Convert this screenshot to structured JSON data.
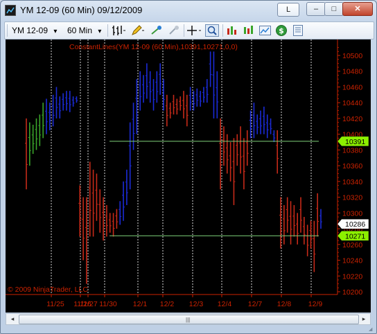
{
  "window": {
    "title": "YM 12-09 (60 Min)  09/12/2009",
    "link_button": "L",
    "minimize": "–",
    "maximize": "□",
    "close": "✕"
  },
  "toolbar": {
    "instrument": "YM 12-09",
    "interval": "60 Min",
    "dropdown": "▾",
    "icons": [
      "bar-type-icon",
      "pencil-icon",
      "crosshair-tool-icon",
      "eraser-icon",
      "crosshair-icon",
      "zoom-icon",
      "indicators-icon",
      "strategies-icon",
      "properties-icon",
      "dollar-icon",
      "data-box-icon"
    ]
  },
  "chart": {
    "indicator_label": "ConstantLines(YM 12-09 (60 Min),10391,10271,0,0)",
    "copyright": "© 2009 NinjaTrader, LLC",
    "colors": {
      "up": "#1b2bd6",
      "down": "#c62a19",
      "neutral": "#3aa52a",
      "axis": "#cc2200",
      "line": "#7fd37a",
      "grid": "#ffffff"
    },
    "price_labels": [
      "10500",
      "10480",
      "10460",
      "10440",
      "10420",
      "10400",
      "10380",
      "10360",
      "10340",
      "10320",
      "10300",
      "10280",
      "10260",
      "10240",
      "10220",
      "10200"
    ],
    "flags": {
      "upper": "10391",
      "last": "10286",
      "lower": "10271"
    },
    "date_labels": [
      "11/25",
      "11/26",
      "11/27",
      "11/30",
      "12/1",
      "12/2",
      "12/3",
      "12/4",
      "12/7",
      "12/8",
      "12/9"
    ]
  },
  "chart_data": {
    "type": "ohlc",
    "title": "ConstantLines(YM 12-09 (60 Min),10391,10271,0,0)",
    "ylim": [
      10200,
      10510
    ],
    "constant_lines": [
      10391,
      10271
    ],
    "last_price": 10286,
    "x_categories": [
      "11/25",
      "11/26",
      "11/27",
      "11/30",
      "12/1",
      "12/2",
      "12/3",
      "12/4",
      "12/7",
      "12/8",
      "12/9"
    ],
    "bars": [
      {
        "h": 10420,
        "l": 10330,
        "c": "down"
      },
      {
        "h": 10415,
        "l": 10360,
        "c": "neutral"
      },
      {
        "h": 10412,
        "l": 10375,
        "c": "neutral"
      },
      {
        "h": 10420,
        "l": 10380,
        "c": "neutral"
      },
      {
        "h": 10425,
        "l": 10385,
        "c": "neutral"
      },
      {
        "h": 10440,
        "l": 10395,
        "c": "neutral"
      },
      {
        "h": 10445,
        "l": 10400,
        "c": "up"
      },
      {
        "h": 10440,
        "l": 10405,
        "c": "up"
      },
      {
        "h": 10450,
        "l": 10410,
        "c": "up"
      },
      {
        "h": 10460,
        "l": 10420,
        "c": "up"
      },
      {
        "h": 10448,
        "l": 10420,
        "c": "up"
      },
      {
        "h": 10452,
        "l": 10430,
        "c": "up"
      },
      {
        "h": 10455,
        "l": 10430,
        "c": "up"
      },
      {
        "h": 10455,
        "l": 10428,
        "c": "up"
      },
      {
        "h": 10448,
        "l": 10435,
        "c": "up"
      },
      {
        "h": 10448,
        "l": 10440,
        "c": "up"
      },
      {
        "h": 10335,
        "l": 10270,
        "c": "down"
      },
      {
        "h": 10320,
        "l": 10240,
        "c": "down"
      },
      {
        "h": 10320,
        "l": 10210,
        "c": "down"
      },
      {
        "h": 10365,
        "l": 10270,
        "c": "down"
      },
      {
        "h": 10355,
        "l": 10270,
        "c": "down"
      },
      {
        "h": 10350,
        "l": 10290,
        "c": "down"
      },
      {
        "h": 10330,
        "l": 10275,
        "c": "down"
      },
      {
        "h": 10320,
        "l": 10265,
        "c": "down"
      },
      {
        "h": 10310,
        "l": 10270,
        "c": "down"
      },
      {
        "h": 10300,
        "l": 10275,
        "c": "down"
      },
      {
        "h": 10300,
        "l": 10270,
        "c": "down"
      },
      {
        "h": 10305,
        "l": 10280,
        "c": "down"
      },
      {
        "h": 10315,
        "l": 10285,
        "c": "up"
      },
      {
        "h": 10340,
        "l": 10290,
        "c": "up"
      },
      {
        "h": 10355,
        "l": 10310,
        "c": "up"
      },
      {
        "h": 10415,
        "l": 10330,
        "c": "up"
      },
      {
        "h": 10440,
        "l": 10380,
        "c": "up"
      },
      {
        "h": 10470,
        "l": 10400,
        "c": "up"
      },
      {
        "h": 10480,
        "l": 10430,
        "c": "up"
      },
      {
        "h": 10475,
        "l": 10440,
        "c": "up"
      },
      {
        "h": 10490,
        "l": 10445,
        "c": "up"
      },
      {
        "h": 10480,
        "l": 10440,
        "c": "up"
      },
      {
        "h": 10470,
        "l": 10430,
        "c": "up"
      },
      {
        "h": 10480,
        "l": 10440,
        "c": "up"
      },
      {
        "h": 10490,
        "l": 10450,
        "c": "up"
      },
      {
        "h": 10470,
        "l": 10430,
        "c": "up"
      },
      {
        "h": 10450,
        "l": 10410,
        "c": "down"
      },
      {
        "h": 10440,
        "l": 10420,
        "c": "down"
      },
      {
        "h": 10450,
        "l": 10425,
        "c": "down"
      },
      {
        "h": 10445,
        "l": 10425,
        "c": "down"
      },
      {
        "h": 10448,
        "l": 10430,
        "c": "down"
      },
      {
        "h": 10455,
        "l": 10420,
        "c": "down"
      },
      {
        "h": 10450,
        "l": 10410,
        "c": "down"
      },
      {
        "h": 10460,
        "l": 10430,
        "c": "up"
      },
      {
        "h": 10455,
        "l": 10430,
        "c": "up"
      },
      {
        "h": 10458,
        "l": 10435,
        "c": "up"
      },
      {
        "h": 10455,
        "l": 10435,
        "c": "up"
      },
      {
        "h": 10460,
        "l": 10440,
        "c": "up"
      },
      {
        "h": 10470,
        "l": 10440,
        "c": "up"
      },
      {
        "h": 10505,
        "l": 10460,
        "c": "up"
      },
      {
        "h": 10505,
        "l": 10420,
        "c": "up"
      },
      {
        "h": 10480,
        "l": 10420,
        "c": "up"
      },
      {
        "h": 10420,
        "l": 10330,
        "c": "down"
      },
      {
        "h": 10410,
        "l": 10360,
        "c": "down"
      },
      {
        "h": 10400,
        "l": 10350,
        "c": "down"
      },
      {
        "h": 10390,
        "l": 10340,
        "c": "down"
      },
      {
        "h": 10395,
        "l": 10310,
        "c": "down"
      },
      {
        "h": 10400,
        "l": 10360,
        "c": "down"
      },
      {
        "h": 10410,
        "l": 10350,
        "c": "down"
      },
      {
        "h": 10395,
        "l": 10330,
        "c": "down"
      },
      {
        "h": 10405,
        "l": 10360,
        "c": "down"
      },
      {
        "h": 10430,
        "l": 10395,
        "c": "up"
      },
      {
        "h": 10440,
        "l": 10395,
        "c": "up"
      },
      {
        "h": 10425,
        "l": 10400,
        "c": "up"
      },
      {
        "h": 10430,
        "l": 10400,
        "c": "up"
      },
      {
        "h": 10435,
        "l": 10400,
        "c": "up"
      },
      {
        "h": 10425,
        "l": 10395,
        "c": "up"
      },
      {
        "h": 10420,
        "l": 10400,
        "c": "up"
      },
      {
        "h": 10405,
        "l": 10390,
        "c": "up"
      },
      {
        "h": 10405,
        "l": 10350,
        "c": "down"
      },
      {
        "h": 10320,
        "l": 10255,
        "c": "down"
      },
      {
        "h": 10310,
        "l": 10260,
        "c": "down"
      },
      {
        "h": 10320,
        "l": 10275,
        "c": "down"
      },
      {
        "h": 10315,
        "l": 10260,
        "c": "down"
      },
      {
        "h": 10310,
        "l": 10270,
        "c": "down"
      },
      {
        "h": 10300,
        "l": 10260,
        "c": "down"
      },
      {
        "h": 10320,
        "l": 10275,
        "c": "down"
      },
      {
        "h": 10295,
        "l": 10260,
        "c": "down"
      },
      {
        "h": 10285,
        "l": 10245,
        "c": "down"
      },
      {
        "h": 10290,
        "l": 10255,
        "c": "down"
      },
      {
        "h": 10290,
        "l": 10225,
        "c": "down"
      },
      {
        "h": 10325,
        "l": 10270,
        "c": "down"
      },
      {
        "h": 10305,
        "l": 10280,
        "c": "up"
      }
    ]
  },
  "scrollbar": {
    "left": "◂",
    "right": "▸",
    "grip": "|||"
  }
}
